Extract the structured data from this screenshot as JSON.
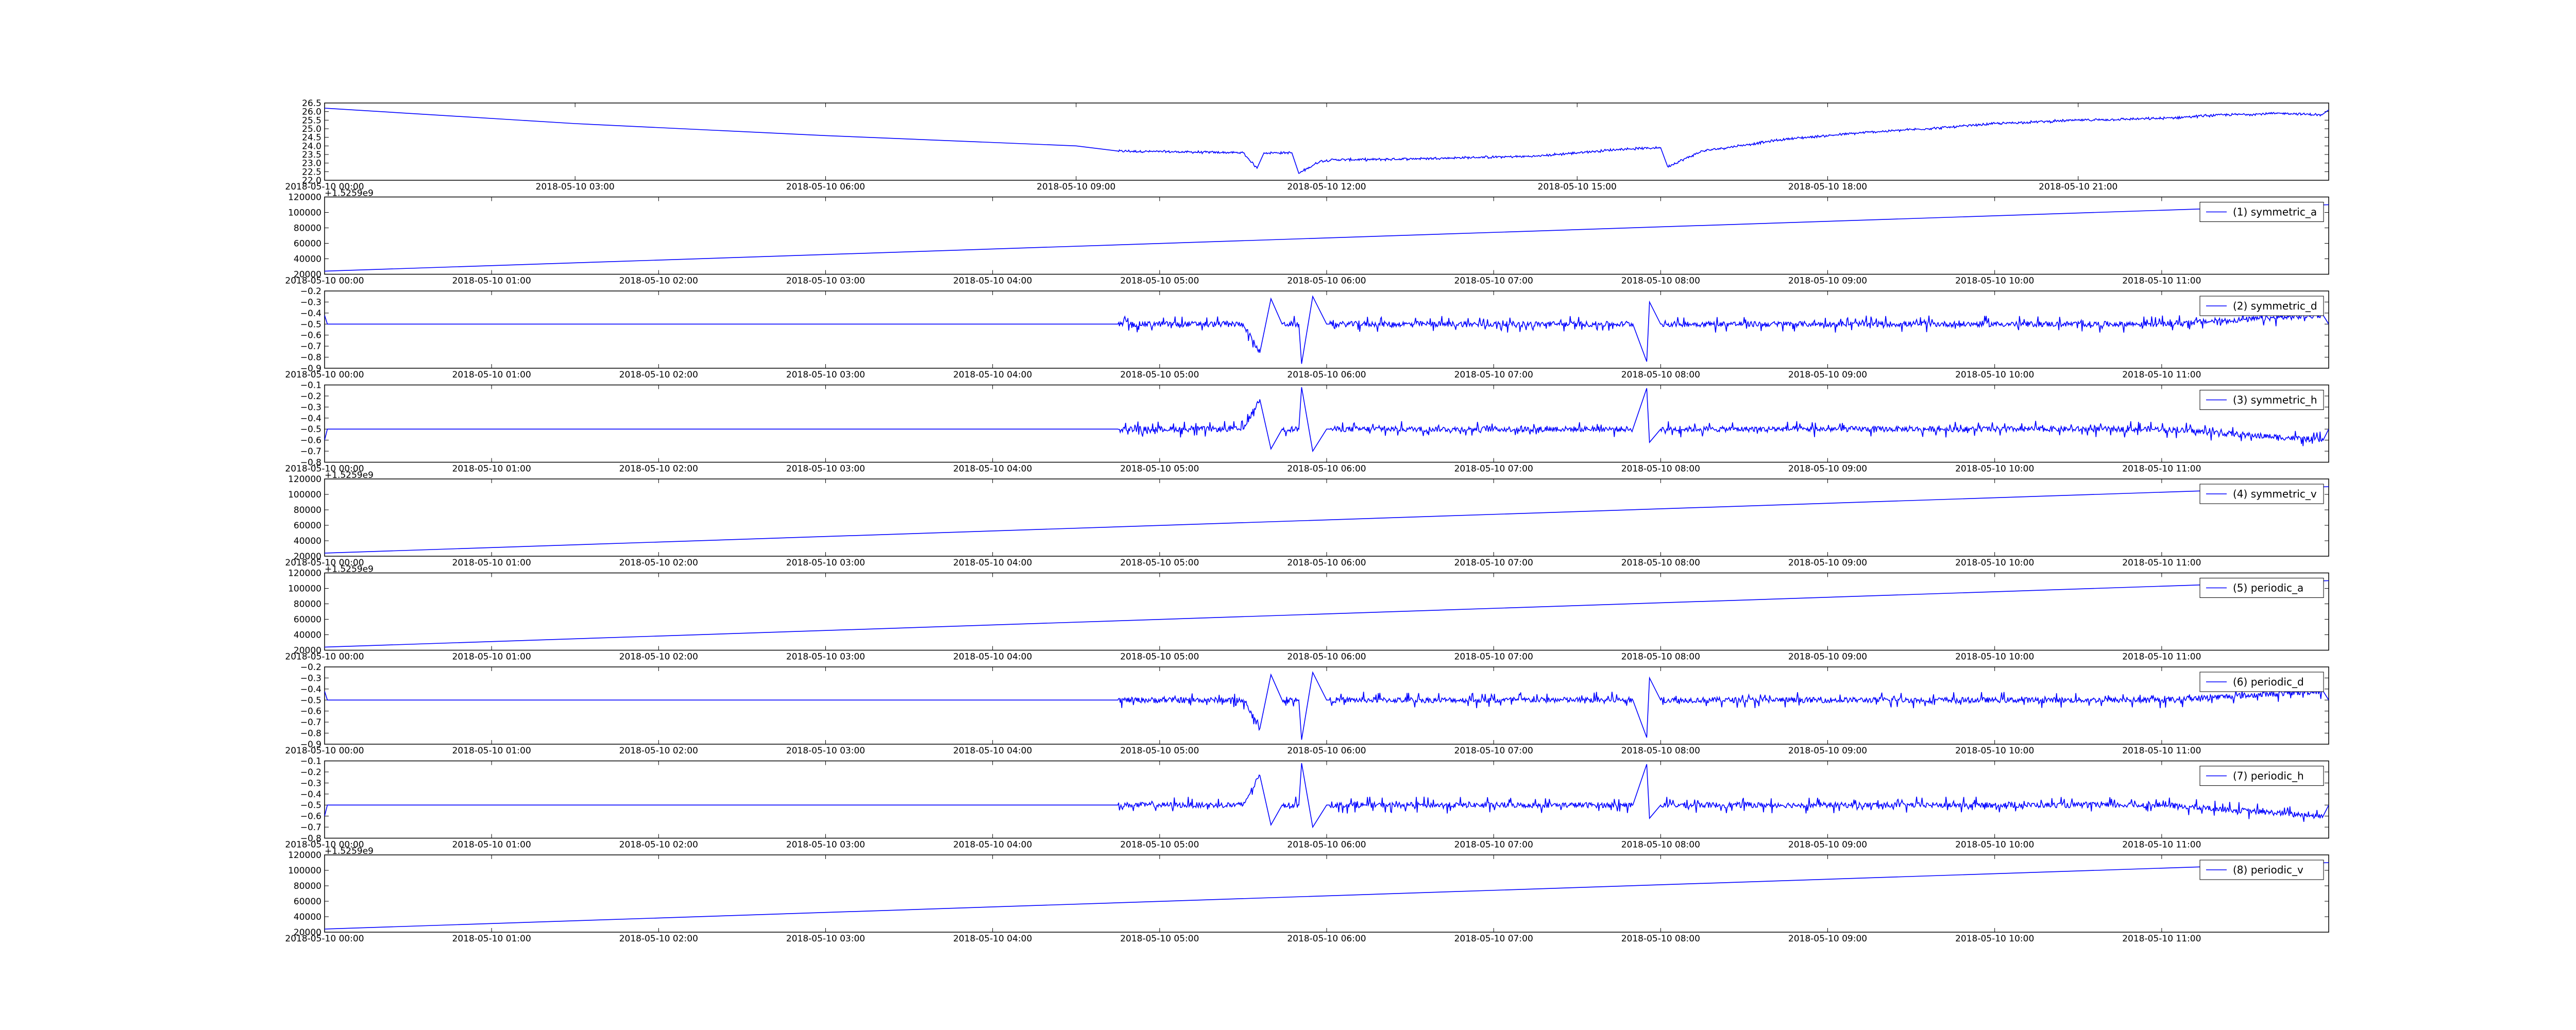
{
  "figure": {
    "background": "#ffffff",
    "line_color": "#0000ff"
  },
  "chart_data": [
    {
      "id": "temp",
      "type": "line",
      "x_axis": "datetime",
      "xlim": [
        "2018-05-10 00:00",
        "2018-05-11 00:00"
      ],
      "ylim": [
        22.0,
        26.5
      ],
      "yticks": [
        22.0,
        22.5,
        23.0,
        23.5,
        24.0,
        24.5,
        25.0,
        25.5,
        26.0,
        26.5
      ],
      "ytick_labels": [
        "22.0",
        "22.5",
        "23.0",
        "23.5",
        "24.0",
        "24.5",
        "25.0",
        "25.5",
        "26.0",
        "26.5"
      ],
      "xticks": [
        "2018-05-10 00:00",
        "2018-05-10 03:00",
        "2018-05-10 06:00",
        "2018-05-10 09:00",
        "2018-05-10 12:00",
        "2018-05-10 15:00",
        "2018-05-10 18:00",
        "2018-05-10 21:00"
      ],
      "xtick_labels": [
        "2018-05-10 00:00",
        "2018-05-10 03:00",
        "2018-05-10 06:00",
        "2018-05-10 09:00",
        "2018-05-10 12:00",
        "2018-05-10 15:00",
        "2018-05-10 18:00",
        "2018-05-10 21:00"
      ],
      "legend": null,
      "offset_label": "",
      "grid": false,
      "series": [
        {
          "x": [
            "2018-05-10 00:00",
            "2018-05-10 03:00",
            "2018-05-10 06:00",
            "2018-05-10 09:00",
            "2018-05-10 09:30",
            "2018-05-10 11:00",
            "2018-05-10 11:10",
            "2018-05-10 11:15",
            "2018-05-10 11:35",
            "2018-05-10 11:40",
            "2018-05-10 11:55",
            "2018-05-10 12:05",
            "2018-05-10 12:30",
            "2018-05-10 13:30",
            "2018-05-10 14:30",
            "2018-05-10 15:30",
            "2018-05-10 16:00",
            "2018-05-10 16:05",
            "2018-05-10 16:30",
            "2018-05-10 17:30",
            "2018-05-10 18:30",
            "2018-05-10 19:30",
            "2018-05-10 20:00",
            "2018-05-10 21:00",
            "2018-05-10 22:00",
            "2018-05-10 22:40",
            "2018-05-10 23:30",
            "2018-05-10 23:55",
            "2018-05-11 00:00"
          ],
          "values": [
            26.2,
            25.3,
            24.6,
            24.0,
            23.7,
            23.6,
            22.7,
            23.6,
            23.6,
            22.4,
            23.1,
            23.2,
            23.2,
            23.3,
            23.4,
            23.8,
            23.9,
            22.8,
            23.7,
            24.4,
            24.8,
            25.1,
            25.3,
            25.5,
            25.6,
            25.8,
            25.9,
            25.8,
            26.1
          ]
        }
      ]
    },
    {
      "id": "symmetric_a",
      "type": "line",
      "x_axis": "datetime",
      "xlim": [
        "2018-05-10 00:00",
        "2018-05-10 12:00"
      ],
      "ylim": [
        20000,
        120000
      ],
      "yticks": [
        20000,
        40000,
        60000,
        80000,
        100000,
        120000
      ],
      "ytick_labels": [
        "20000",
        "40000",
        "60000",
        "80000",
        "100000",
        "120000"
      ],
      "xticks": [
        "2018-05-10 00:00",
        "2018-05-10 01:00",
        "2018-05-10 02:00",
        "2018-05-10 03:00",
        "2018-05-10 04:00",
        "2018-05-10 05:00",
        "2018-05-10 06:00",
        "2018-05-10 07:00",
        "2018-05-10 08:00",
        "2018-05-10 09:00",
        "2018-05-10 10:00",
        "2018-05-10 11:00"
      ],
      "xtick_labels": [
        "2018-05-10 00:00",
        "2018-05-10 01:00",
        "2018-05-10 02:00",
        "2018-05-10 03:00",
        "2018-05-10 04:00",
        "2018-05-10 05:00",
        "2018-05-10 06:00",
        "2018-05-10 07:00",
        "2018-05-10 08:00",
        "2018-05-10 09:00",
        "2018-05-10 10:00",
        "2018-05-10 11:00"
      ],
      "legend": "(1) symmetric_a",
      "legend_loc": "top-right",
      "offset_label": "+1.5259e9",
      "grid": false,
      "series": [
        {
          "name": "(1) symmetric_a",
          "x": [
            "2018-05-10 00:00",
            "2018-05-10 12:00"
          ],
          "values": [
            24000,
            110000
          ]
        }
      ]
    },
    {
      "id": "symmetric_d",
      "type": "line",
      "x_axis": "datetime",
      "xlim": [
        "2018-05-10 00:00",
        "2018-05-10 12:00"
      ],
      "ylim": [
        -0.9,
        -0.2
      ],
      "yticks": [
        -0.9,
        -0.8,
        -0.7,
        -0.6,
        -0.5,
        -0.4,
        -0.3,
        -0.2
      ],
      "ytick_labels": [
        "−0.9",
        "−0.8",
        "−0.7",
        "−0.6",
        "−0.5",
        "−0.4",
        "−0.3",
        "−0.2"
      ],
      "xticks": [
        "2018-05-10 00:00",
        "2018-05-10 01:00",
        "2018-05-10 02:00",
        "2018-05-10 03:00",
        "2018-05-10 04:00",
        "2018-05-10 05:00",
        "2018-05-10 06:00",
        "2018-05-10 07:00",
        "2018-05-10 08:00",
        "2018-05-10 09:00",
        "2018-05-10 10:00",
        "2018-05-10 11:00"
      ],
      "xtick_labels": [
        "2018-05-10 00:00",
        "2018-05-10 01:00",
        "2018-05-10 02:00",
        "2018-05-10 03:00",
        "2018-05-10 04:00",
        "2018-05-10 05:00",
        "2018-05-10 06:00",
        "2018-05-10 07:00",
        "2018-05-10 08:00",
        "2018-05-10 09:00",
        "2018-05-10 10:00",
        "2018-05-10 11:00"
      ],
      "legend": "(2) symmetric_d",
      "legend_loc": "top-right",
      "offset_label": "",
      "grid": false,
      "series": [
        {
          "name": "(2) symmetric_d",
          "x": [
            "2018-05-10 00:00",
            "2018-05-10 00:01",
            "2018-05-10 00:02",
            "2018-05-10 04:45",
            "2018-05-10 05:30",
            "2018-05-10 05:36",
            "2018-05-10 05:40",
            "2018-05-10 05:44",
            "2018-05-10 05:50",
            "2018-05-10 05:51",
            "2018-05-10 05:55",
            "2018-05-10 06:00",
            "2018-05-10 06:01",
            "2018-05-10 06:30",
            "2018-05-10 07:00",
            "2018-05-10 07:50",
            "2018-05-10 07:55",
            "2018-05-10 07:56",
            "2018-05-10 08:00",
            "2018-05-10 09:00",
            "2018-05-10 10:00",
            "2018-05-10 11:00",
            "2018-05-10 11:58",
            "2018-05-10 12:00"
          ],
          "values": [
            -0.42,
            -0.5,
            -0.5,
            -0.5,
            -0.5,
            -0.76,
            -0.27,
            -0.5,
            -0.5,
            -0.86,
            -0.25,
            -0.5,
            -0.5,
            -0.5,
            -0.5,
            -0.5,
            -0.84,
            -0.3,
            -0.5,
            -0.5,
            -0.5,
            -0.5,
            -0.42,
            -0.5
          ]
        }
      ]
    },
    {
      "id": "symmetric_h",
      "type": "line",
      "x_axis": "datetime",
      "xlim": [
        "2018-05-10 00:00",
        "2018-05-10 12:00"
      ],
      "ylim": [
        -0.8,
        -0.1
      ],
      "yticks": [
        -0.8,
        -0.7,
        -0.6,
        -0.5,
        -0.4,
        -0.3,
        -0.2,
        -0.1
      ],
      "ytick_labels": [
        "−0.8",
        "−0.7",
        "−0.6",
        "−0.5",
        "−0.4",
        "−0.3",
        "−0.2",
        "−0.1"
      ],
      "xticks": [
        "2018-05-10 00:00",
        "2018-05-10 01:00",
        "2018-05-10 02:00",
        "2018-05-10 03:00",
        "2018-05-10 04:00",
        "2018-05-10 05:00",
        "2018-05-10 06:00",
        "2018-05-10 07:00",
        "2018-05-10 08:00",
        "2018-05-10 09:00",
        "2018-05-10 10:00",
        "2018-05-10 11:00"
      ],
      "xtick_labels": [
        "2018-05-10 00:00",
        "2018-05-10 01:00",
        "2018-05-10 02:00",
        "2018-05-10 03:00",
        "2018-05-10 04:00",
        "2018-05-10 05:00",
        "2018-05-10 06:00",
        "2018-05-10 07:00",
        "2018-05-10 08:00",
        "2018-05-10 09:00",
        "2018-05-10 10:00",
        "2018-05-10 11:00"
      ],
      "legend": "(3) symmetric_h",
      "legend_loc": "top-right",
      "offset_label": "",
      "grid": false,
      "series": [
        {
          "name": "(3) symmetric_h",
          "x": [
            "2018-05-10 00:00",
            "2018-05-10 00:01",
            "2018-05-10 00:02",
            "2018-05-10 04:45",
            "2018-05-10 05:30",
            "2018-05-10 05:36",
            "2018-05-10 05:40",
            "2018-05-10 05:44",
            "2018-05-10 05:50",
            "2018-05-10 05:51",
            "2018-05-10 05:55",
            "2018-05-10 06:00",
            "2018-05-10 06:01",
            "2018-05-10 06:30",
            "2018-05-10 07:00",
            "2018-05-10 07:50",
            "2018-05-10 07:55",
            "2018-05-10 07:56",
            "2018-05-10 08:00",
            "2018-05-10 09:00",
            "2018-05-10 10:00",
            "2018-05-10 11:00",
            "2018-05-10 11:58",
            "2018-05-10 12:00"
          ],
          "values": [
            -0.6,
            -0.5,
            -0.5,
            -0.5,
            -0.5,
            -0.23,
            -0.68,
            -0.5,
            -0.5,
            -0.12,
            -0.7,
            -0.5,
            -0.5,
            -0.5,
            -0.5,
            -0.5,
            -0.13,
            -0.62,
            -0.5,
            -0.5,
            -0.5,
            -0.5,
            -0.6,
            -0.5
          ]
        }
      ]
    },
    {
      "id": "symmetric_v",
      "type": "line",
      "x_axis": "datetime",
      "xlim": [
        "2018-05-10 00:00",
        "2018-05-10 12:00"
      ],
      "ylim": [
        20000,
        120000
      ],
      "yticks": [
        20000,
        40000,
        60000,
        80000,
        100000,
        120000
      ],
      "ytick_labels": [
        "20000",
        "40000",
        "60000",
        "80000",
        "100000",
        "120000"
      ],
      "xticks": [
        "2018-05-10 00:00",
        "2018-05-10 01:00",
        "2018-05-10 02:00",
        "2018-05-10 03:00",
        "2018-05-10 04:00",
        "2018-05-10 05:00",
        "2018-05-10 06:00",
        "2018-05-10 07:00",
        "2018-05-10 08:00",
        "2018-05-10 09:00",
        "2018-05-10 10:00",
        "2018-05-10 11:00"
      ],
      "xtick_labels": [
        "2018-05-10 00:00",
        "2018-05-10 01:00",
        "2018-05-10 02:00",
        "2018-05-10 03:00",
        "2018-05-10 04:00",
        "2018-05-10 05:00",
        "2018-05-10 06:00",
        "2018-05-10 07:00",
        "2018-05-10 08:00",
        "2018-05-10 09:00",
        "2018-05-10 10:00",
        "2018-05-10 11:00"
      ],
      "legend": "(4) symmetric_v",
      "legend_loc": "top-right",
      "offset_label": "+1.5259e9",
      "grid": false,
      "series": [
        {
          "name": "(4) symmetric_v",
          "x": [
            "2018-05-10 00:00",
            "2018-05-10 12:00"
          ],
          "values": [
            24000,
            110000
          ]
        }
      ]
    },
    {
      "id": "periodic_a",
      "type": "line",
      "x_axis": "datetime",
      "xlim": [
        "2018-05-10 00:00",
        "2018-05-10 12:00"
      ],
      "ylim": [
        20000,
        120000
      ],
      "yticks": [
        20000,
        40000,
        60000,
        80000,
        100000,
        120000
      ],
      "ytick_labels": [
        "20000",
        "40000",
        "60000",
        "80000",
        "100000",
        "120000"
      ],
      "xticks": [
        "2018-05-10 00:00",
        "2018-05-10 01:00",
        "2018-05-10 02:00",
        "2018-05-10 03:00",
        "2018-05-10 04:00",
        "2018-05-10 05:00",
        "2018-05-10 06:00",
        "2018-05-10 07:00",
        "2018-05-10 08:00",
        "2018-05-10 09:00",
        "2018-05-10 10:00",
        "2018-05-10 11:00"
      ],
      "xtick_labels": [
        "2018-05-10 00:00",
        "2018-05-10 01:00",
        "2018-05-10 02:00",
        "2018-05-10 03:00",
        "2018-05-10 04:00",
        "2018-05-10 05:00",
        "2018-05-10 06:00",
        "2018-05-10 07:00",
        "2018-05-10 08:00",
        "2018-05-10 09:00",
        "2018-05-10 10:00",
        "2018-05-10 11:00"
      ],
      "legend": "(5) periodic_a",
      "legend_loc": "top-right",
      "offset_label": "+1.5259e9",
      "grid": false,
      "series": [
        {
          "name": "(5) periodic_a",
          "x": [
            "2018-05-10 00:00",
            "2018-05-10 12:00"
          ],
          "values": [
            24000,
            110000
          ]
        }
      ]
    },
    {
      "id": "periodic_d",
      "type": "line",
      "x_axis": "datetime",
      "xlim": [
        "2018-05-10 00:00",
        "2018-05-10 12:00"
      ],
      "ylim": [
        -0.9,
        -0.2
      ],
      "yticks": [
        -0.9,
        -0.8,
        -0.7,
        -0.6,
        -0.5,
        -0.4,
        -0.3,
        -0.2
      ],
      "ytick_labels": [
        "−0.9",
        "−0.8",
        "−0.7",
        "−0.6",
        "−0.5",
        "−0.4",
        "−0.3",
        "−0.2"
      ],
      "xticks": [
        "2018-05-10 00:00",
        "2018-05-10 01:00",
        "2018-05-10 02:00",
        "2018-05-10 03:00",
        "2018-05-10 04:00",
        "2018-05-10 05:00",
        "2018-05-10 06:00",
        "2018-05-10 07:00",
        "2018-05-10 08:00",
        "2018-05-10 09:00",
        "2018-05-10 10:00",
        "2018-05-10 11:00"
      ],
      "xtick_labels": [
        "2018-05-10 00:00",
        "2018-05-10 01:00",
        "2018-05-10 02:00",
        "2018-05-10 03:00",
        "2018-05-10 04:00",
        "2018-05-10 05:00",
        "2018-05-10 06:00",
        "2018-05-10 07:00",
        "2018-05-10 08:00",
        "2018-05-10 09:00",
        "2018-05-10 10:00",
        "2018-05-10 11:00"
      ],
      "legend": "(6) periodic_d",
      "legend_loc": "top-right",
      "offset_label": "",
      "grid": false,
      "series": [
        {
          "name": "(6) periodic_d",
          "x": [
            "2018-05-10 00:00",
            "2018-05-10 00:01",
            "2018-05-10 00:02",
            "2018-05-10 04:45",
            "2018-05-10 05:30",
            "2018-05-10 05:36",
            "2018-05-10 05:40",
            "2018-05-10 05:44",
            "2018-05-10 05:50",
            "2018-05-10 05:51",
            "2018-05-10 05:55",
            "2018-05-10 06:00",
            "2018-05-10 06:01",
            "2018-05-10 06:30",
            "2018-05-10 07:00",
            "2018-05-10 07:50",
            "2018-05-10 07:55",
            "2018-05-10 07:56",
            "2018-05-10 08:00",
            "2018-05-10 09:00",
            "2018-05-10 10:00",
            "2018-05-10 11:00",
            "2018-05-10 11:58",
            "2018-05-10 12:00"
          ],
          "values": [
            -0.42,
            -0.5,
            -0.5,
            -0.5,
            -0.5,
            -0.76,
            -0.27,
            -0.5,
            -0.5,
            -0.86,
            -0.25,
            -0.5,
            -0.5,
            -0.5,
            -0.5,
            -0.5,
            -0.84,
            -0.3,
            -0.5,
            -0.5,
            -0.5,
            -0.5,
            -0.42,
            -0.5
          ]
        }
      ]
    },
    {
      "id": "periodic_h",
      "type": "line",
      "x_axis": "datetime",
      "xlim": [
        "2018-05-10 00:00",
        "2018-05-10 12:00"
      ],
      "ylim": [
        -0.8,
        -0.1
      ],
      "yticks": [
        -0.8,
        -0.7,
        -0.6,
        -0.5,
        -0.4,
        -0.3,
        -0.2,
        -0.1
      ],
      "ytick_labels": [
        "−0.8",
        "−0.7",
        "−0.6",
        "−0.5",
        "−0.4",
        "−0.3",
        "−0.2",
        "−0.1"
      ],
      "xticks": [
        "2018-05-10 00:00",
        "2018-05-10 01:00",
        "2018-05-10 02:00",
        "2018-05-10 03:00",
        "2018-05-10 04:00",
        "2018-05-10 05:00",
        "2018-05-10 06:00",
        "2018-05-10 07:00",
        "2018-05-10 08:00",
        "2018-05-10 09:00",
        "2018-05-10 10:00",
        "2018-05-10 11:00"
      ],
      "xtick_labels": [
        "2018-05-10 00:00",
        "2018-05-10 01:00",
        "2018-05-10 02:00",
        "2018-05-10 03:00",
        "2018-05-10 04:00",
        "2018-05-10 05:00",
        "2018-05-10 06:00",
        "2018-05-10 07:00",
        "2018-05-10 08:00",
        "2018-05-10 09:00",
        "2018-05-10 10:00",
        "2018-05-10 11:00"
      ],
      "legend": "(7) periodic_h",
      "legend_loc": "top-right",
      "offset_label": "",
      "grid": false,
      "series": [
        {
          "name": "(7) periodic_h",
          "x": [
            "2018-05-10 00:00",
            "2018-05-10 00:01",
            "2018-05-10 00:02",
            "2018-05-10 04:45",
            "2018-05-10 05:30",
            "2018-05-10 05:36",
            "2018-05-10 05:40",
            "2018-05-10 05:44",
            "2018-05-10 05:50",
            "2018-05-10 05:51",
            "2018-05-10 05:55",
            "2018-05-10 06:00",
            "2018-05-10 06:01",
            "2018-05-10 06:30",
            "2018-05-10 07:00",
            "2018-05-10 07:50",
            "2018-05-10 07:55",
            "2018-05-10 07:56",
            "2018-05-10 08:00",
            "2018-05-10 09:00",
            "2018-05-10 10:00",
            "2018-05-10 11:00",
            "2018-05-10 11:58",
            "2018-05-10 12:00"
          ],
          "values": [
            -0.6,
            -0.5,
            -0.5,
            -0.5,
            -0.5,
            -0.23,
            -0.68,
            -0.5,
            -0.5,
            -0.12,
            -0.7,
            -0.5,
            -0.5,
            -0.5,
            -0.5,
            -0.5,
            -0.13,
            -0.62,
            -0.5,
            -0.5,
            -0.5,
            -0.5,
            -0.6,
            -0.5
          ]
        }
      ]
    },
    {
      "id": "periodic_v",
      "type": "line",
      "x_axis": "datetime",
      "xlim": [
        "2018-05-10 00:00",
        "2018-05-10 12:00"
      ],
      "ylim": [
        20000,
        120000
      ],
      "yticks": [
        20000,
        40000,
        60000,
        80000,
        100000,
        120000
      ],
      "ytick_labels": [
        "20000",
        "40000",
        "60000",
        "80000",
        "100000",
        "120000"
      ],
      "xticks": [
        "2018-05-10 00:00",
        "2018-05-10 01:00",
        "2018-05-10 02:00",
        "2018-05-10 03:00",
        "2018-05-10 04:00",
        "2018-05-10 05:00",
        "2018-05-10 06:00",
        "2018-05-10 07:00",
        "2018-05-10 08:00",
        "2018-05-10 09:00",
        "2018-05-10 10:00",
        "2018-05-10 11:00"
      ],
      "xtick_labels": [
        "2018-05-10 00:00",
        "2018-05-10 01:00",
        "2018-05-10 02:00",
        "2018-05-10 03:00",
        "2018-05-10 04:00",
        "2018-05-10 05:00",
        "2018-05-10 06:00",
        "2018-05-10 07:00",
        "2018-05-10 08:00",
        "2018-05-10 09:00",
        "2018-05-10 10:00",
        "2018-05-10 11:00"
      ],
      "legend": "(8) periodic_v",
      "legend_loc": "top-right",
      "offset_label": "+1.5259e9",
      "grid": false,
      "series": [
        {
          "name": "(8) periodic_v",
          "x": [
            "2018-05-10 00:00",
            "2018-05-10 12:00"
          ],
          "values": [
            24000,
            110000
          ]
        }
      ]
    }
  ]
}
